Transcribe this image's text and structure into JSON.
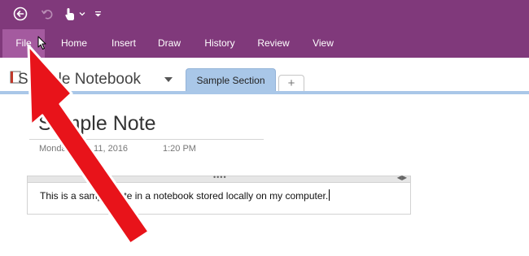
{
  "quick_access": {
    "back_icon": "back-circle-icon",
    "undo_icon": "undo-icon",
    "touch_icon": "touch-mouse-mode-icon",
    "customize_icon": "customize-toolbar-icon"
  },
  "ribbon": {
    "tabs": [
      {
        "label": "File"
      },
      {
        "label": "Home"
      },
      {
        "label": "Insert"
      },
      {
        "label": "Draw"
      },
      {
        "label": "History"
      },
      {
        "label": "Review"
      },
      {
        "label": "View"
      }
    ]
  },
  "notebook": {
    "name": "Sample Notebook",
    "section_tab": "Sample Section",
    "add_section_label": "+"
  },
  "page": {
    "title": "Sample Note",
    "date": "Monday, July 11, 2016",
    "time": "1:20 PM",
    "note_text": "This is a sample note in a notebook stored locally on my computer."
  },
  "colors": {
    "app_accent": "#80397b",
    "file_tab": "#a45a9f",
    "section_tab": "#a9c7e8",
    "annotation_arrow": "#e8131a"
  }
}
